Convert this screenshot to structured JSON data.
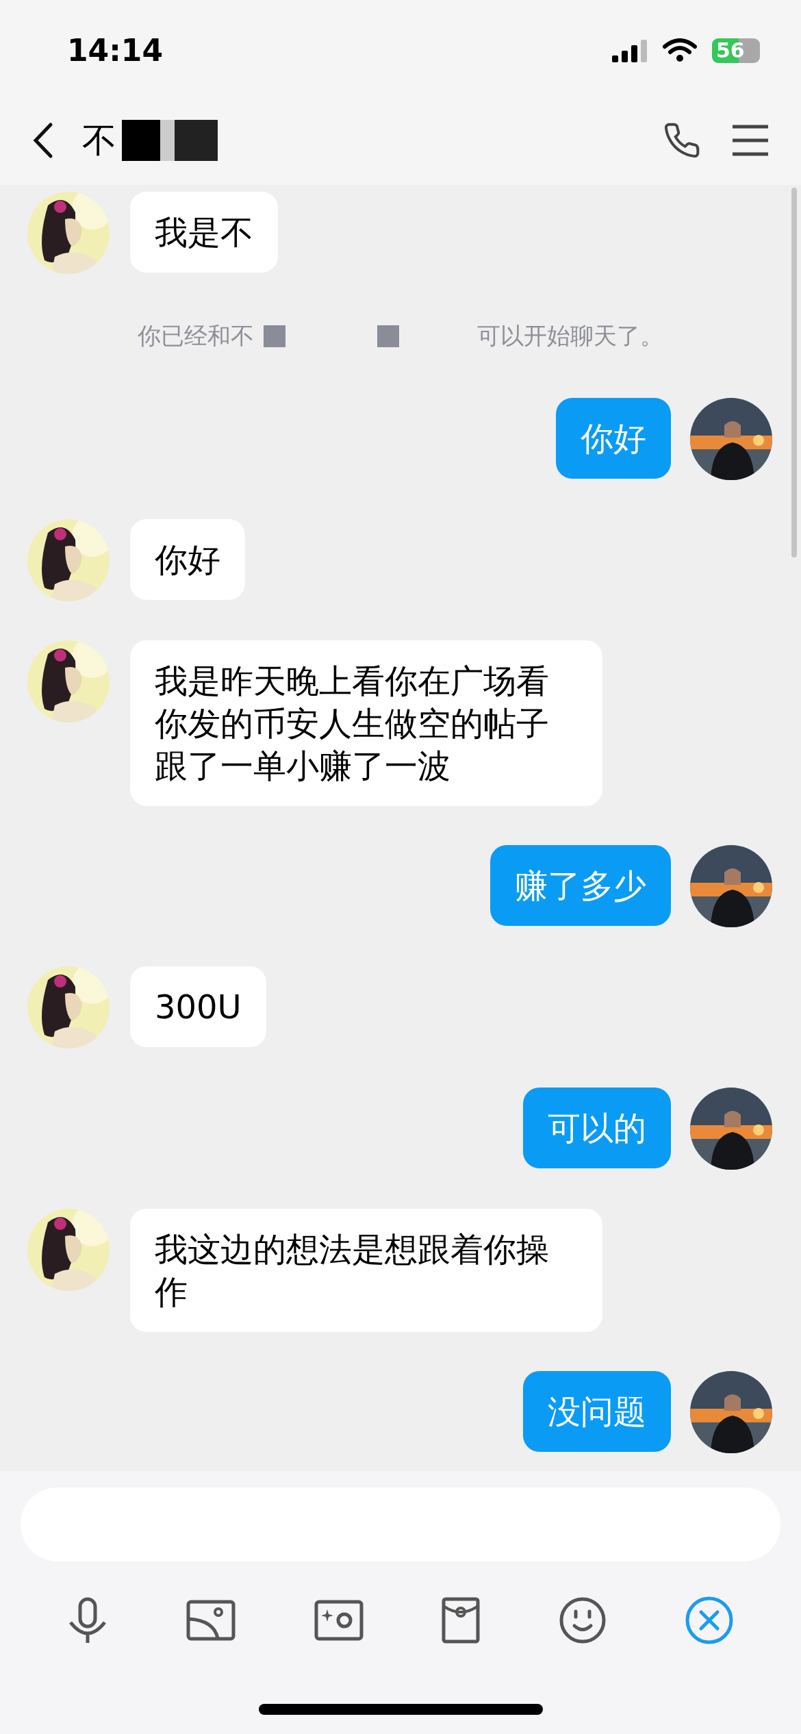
{
  "status_bar": {
    "time": "14:14",
    "battery": "56"
  },
  "header": {
    "title": "不"
  },
  "messages": [
    {
      "kind": "received",
      "text": "我是不"
    },
    {
      "kind": "notice",
      "text": "你已经和不",
      "suffix": "可以开始聊天了。"
    },
    {
      "kind": "sent",
      "text": "你好"
    },
    {
      "kind": "received",
      "text": "你好"
    },
    {
      "kind": "received",
      "text": "我是昨天晚上看你在广场看你发的币安人生做空的帖子跟了一单小赚了一波"
    },
    {
      "kind": "sent",
      "text": "赚了多少"
    },
    {
      "kind": "received",
      "text": "300U"
    },
    {
      "kind": "sent",
      "text": "可以的"
    },
    {
      "kind": "received",
      "text": "我这边的想法是想跟着你操作"
    },
    {
      "kind": "sent",
      "text": "没问题"
    }
  ]
}
